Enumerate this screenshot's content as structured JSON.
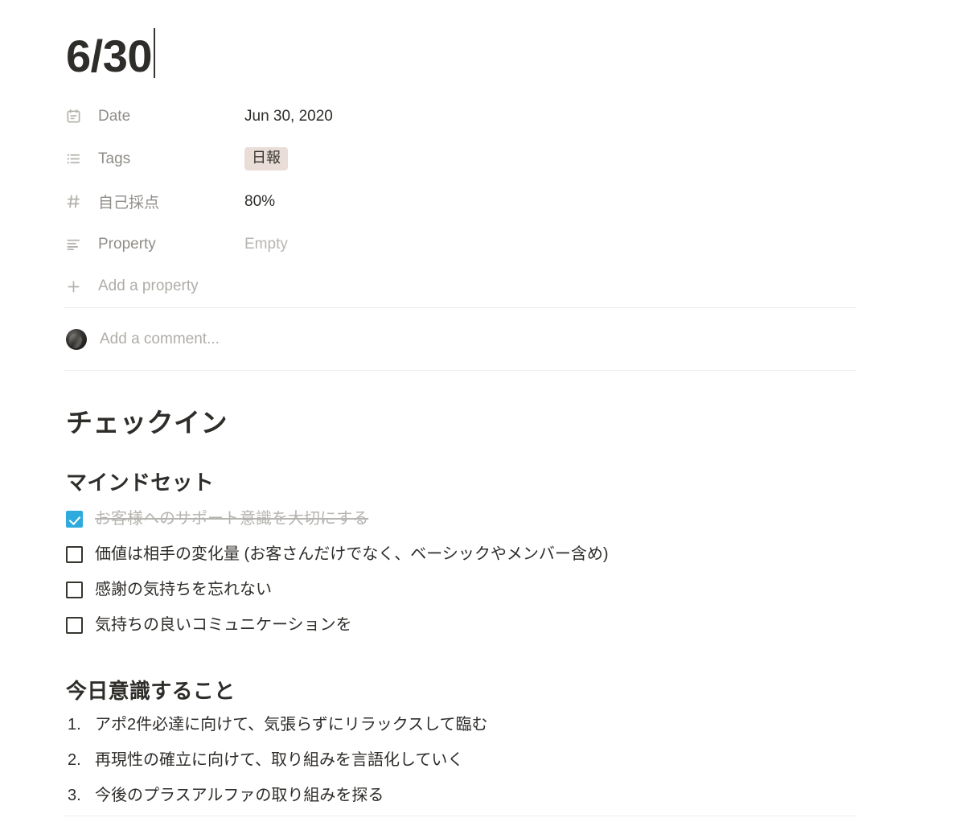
{
  "title": {
    "text": "6/30",
    "has_caret": true
  },
  "properties": [
    {
      "icon": "calendar-icon",
      "label": "Date",
      "value": "Jun 30, 2020",
      "kind": "text"
    },
    {
      "icon": "bulleted-list-icon",
      "label": "Tags",
      "value": "日報",
      "kind": "tag",
      "tag_color": "#eaddd7"
    },
    {
      "icon": "hash-icon",
      "label": "自己採点",
      "value": "80%",
      "kind": "text"
    },
    {
      "icon": "text-align-icon",
      "label": "Property",
      "value": "Empty",
      "kind": "empty"
    }
  ],
  "add_property": {
    "icon": "plus-icon",
    "label": "Add a property"
  },
  "comment": {
    "avatar": "user-avatar",
    "placeholder": "Add a comment..."
  },
  "content": {
    "heading1": "チェックイン",
    "mindset": {
      "heading": "マインドセット",
      "items": [
        {
          "text": "お客様へのサポート意識を大切にする",
          "checked": true
        },
        {
          "text": "価値は相手の変化量 (お客さんだけでなく、ベーシックやメンバー含め)",
          "checked": false
        },
        {
          "text": "感謝の気持ちを忘れない",
          "checked": false
        },
        {
          "text": "気持ちの良いコミュニケーションを",
          "checked": false
        }
      ]
    },
    "today": {
      "heading": "今日意識すること",
      "items": [
        {
          "marker": "1.",
          "text": "アポ2件必達に向けて、気張らずにリラックスして臨む"
        },
        {
          "marker": "2.",
          "text": "再現性の確立に向けて、取り組みを言語化していく"
        },
        {
          "marker": "3.",
          "text": "今後のプラスアルファの取り組みを探る"
        }
      ]
    }
  },
  "colors": {
    "accent_checkbox": "#2eaadc",
    "text_primary": "#2f2d2a",
    "text_muted": "#908d88",
    "text_placeholder": "#b0ada8",
    "divider": "#ededec",
    "tag_background": "#eaddd7"
  }
}
